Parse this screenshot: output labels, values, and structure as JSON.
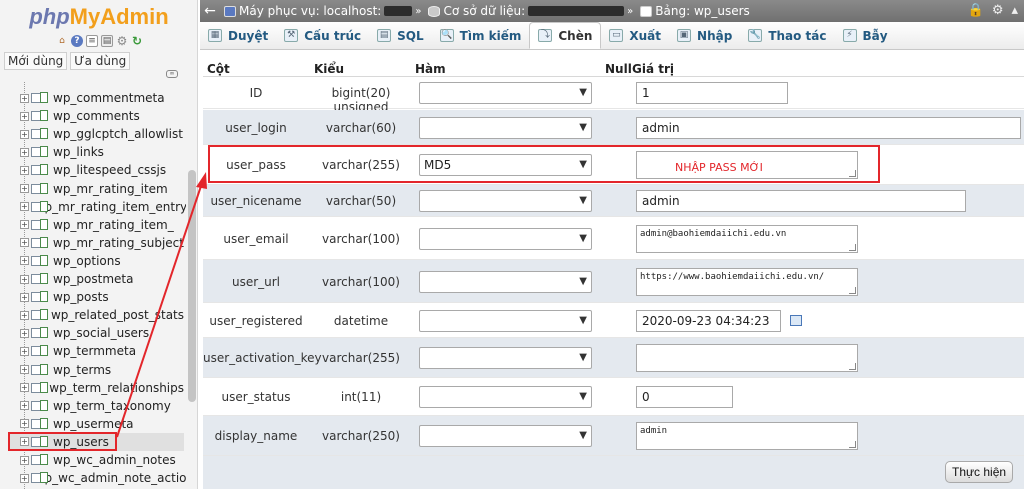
{
  "logo": {
    "php": "php",
    "myadmin": "MyAdmin"
  },
  "logo_icons": [
    "home-icon",
    "help-icon",
    "docs-icon",
    "sql-icon",
    "gear-icon",
    "reload-icon"
  ],
  "sidebar": {
    "recent_label": "Mới dùng",
    "favorites_label": "Ưa dùng",
    "tables": [
      "wp_commentmeta",
      "wp_comments",
      "wp_gglcptch_allowlist",
      "wp_links",
      "wp_litespeed_cssjs",
      "wp_mr_rating_item",
      "wp_mr_rating_item_entry",
      "wp_mr_rating_item_",
      "wp_mr_rating_subject",
      "wp_options",
      "wp_postmeta",
      "wp_posts",
      "wp_related_post_stats",
      "wp_social_users",
      "wp_termmeta",
      "wp_terms",
      "wp_term_relationships",
      "wp_term_taxonomy",
      "wp_usermeta",
      "wp_users",
      "wp_wc_admin_notes",
      "wp_wc_admin_note_action"
    ],
    "active_table": "wp_users"
  },
  "breadcrumb": {
    "server_label": "Máy phục vụ: localhost:",
    "db_label": "Cơ sở dữ liệu:",
    "table_label": "Bảng: wp_users"
  },
  "tabs": [
    {
      "label": "Duyệt",
      "icon": "browse-icon"
    },
    {
      "label": "Cấu trúc",
      "icon": "structure-icon"
    },
    {
      "label": "SQL",
      "icon": "sql-icon"
    },
    {
      "label": "Tìm kiếm",
      "icon": "search-icon"
    },
    {
      "label": "Chèn",
      "icon": "insert-icon",
      "active": true
    },
    {
      "label": "Xuất",
      "icon": "export-icon"
    },
    {
      "label": "Nhập",
      "icon": "import-icon"
    },
    {
      "label": "Thao tác",
      "icon": "operations-icon"
    },
    {
      "label": "Bẫy",
      "icon": "triggers-icon"
    }
  ],
  "form": {
    "headers": {
      "column": "Cột",
      "type": "Kiểu",
      "function": "Hàm",
      "null": "Null",
      "value": "Giá trị"
    },
    "rows": [
      {
        "column": "ID",
        "type": "bigint(20) unsigned",
        "function": "",
        "value": "1"
      },
      {
        "column": "user_login",
        "type": "varchar(60)",
        "function": "",
        "value": "admin"
      },
      {
        "column": "user_pass",
        "type": "varchar(255)",
        "function": "MD5",
        "value": ""
      },
      {
        "column": "user_nicename",
        "type": "varchar(50)",
        "function": "",
        "value": "admin"
      },
      {
        "column": "user_email",
        "type": "varchar(100)",
        "function": "",
        "value": "admin@baohiemdaiichi.edu.vn"
      },
      {
        "column": "user_url",
        "type": "varchar(100)",
        "function": "",
        "value": "https://www.baohiemdaiichi.edu.vn/"
      },
      {
        "column": "user_registered",
        "type": "datetime",
        "function": "",
        "value": "2020-09-23 04:34:23"
      },
      {
        "column": "user_activation_key",
        "type": "varchar(255)",
        "function": "",
        "value": ""
      },
      {
        "column": "user_status",
        "type": "int(11)",
        "function": "",
        "value": "0"
      },
      {
        "column": "display_name",
        "type": "varchar(250)",
        "function": "",
        "value": "admin"
      }
    ],
    "go_label": "Thực hiện"
  },
  "annotation": {
    "text": "NHẬP PASS MỚI",
    "color": "#e3262b"
  },
  "colors": {
    "accent": "#235a81",
    "row_alt": "#e4e9ef",
    "highlight": "#e3262b"
  }
}
